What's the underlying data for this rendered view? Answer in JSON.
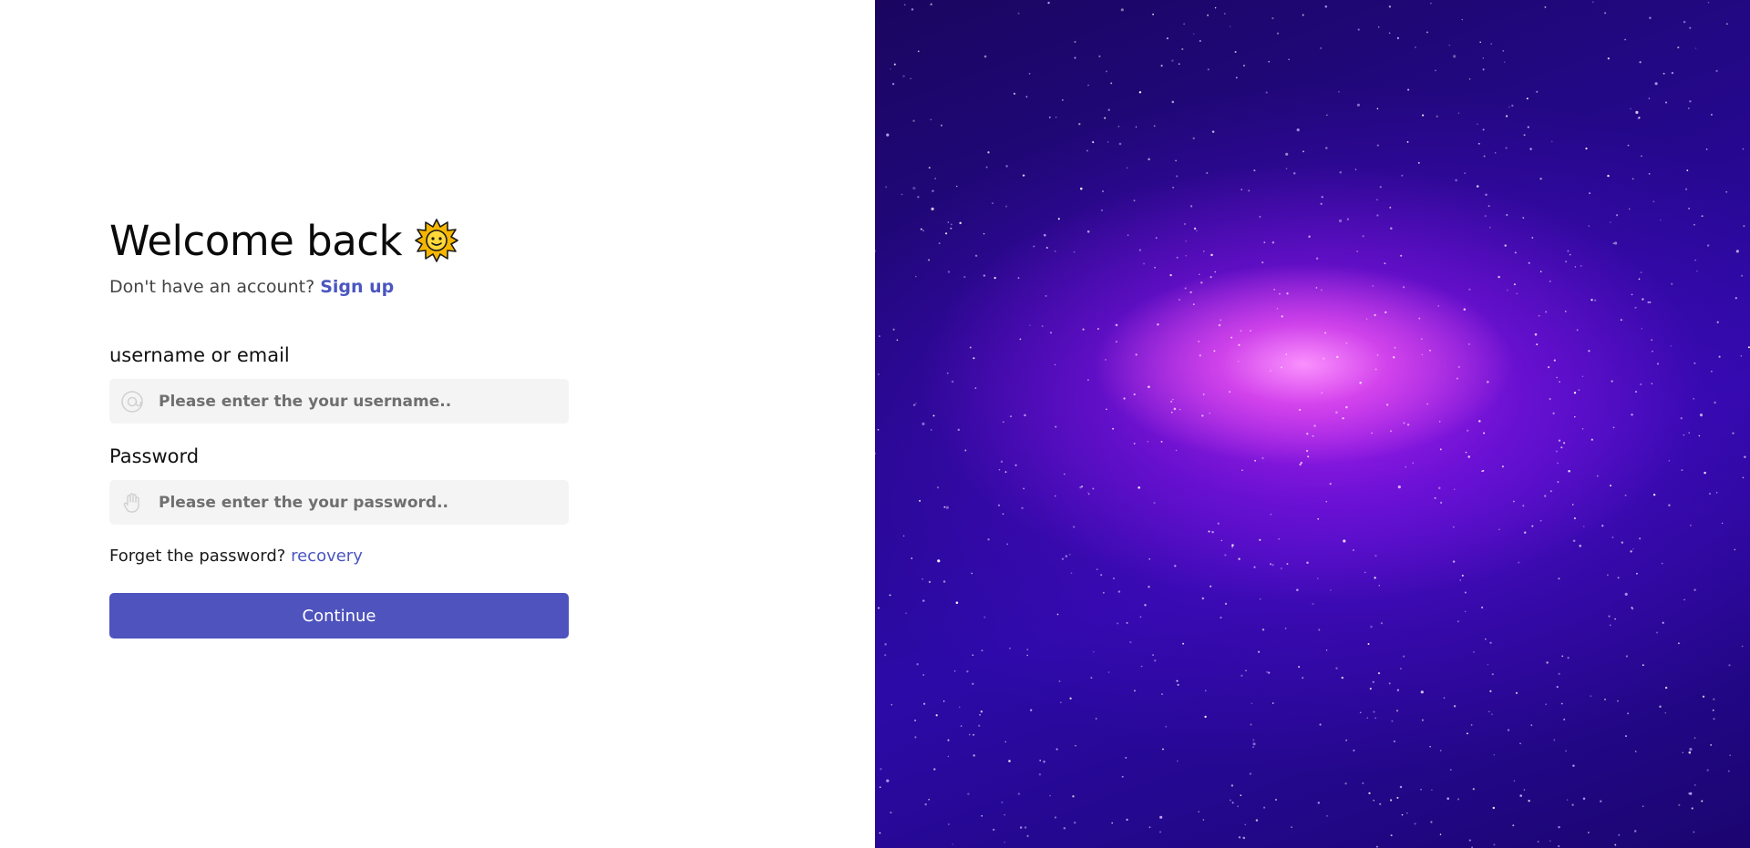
{
  "login": {
    "title": "Welcome back",
    "title_emoji": "sun-with-face",
    "subtitle_text": "Don't have an account?",
    "signup_link": "Sign up",
    "username_label": "username or email",
    "username_placeholder": "Please enter the your username..",
    "username_icon": "at-sign-icon",
    "password_label": "Password",
    "password_placeholder": "Please enter the your password..",
    "password_icon": "hand-icon",
    "forgot_text": "Forget the password?",
    "recovery_link": "recovery",
    "continue_label": "Continue"
  },
  "colors": {
    "accent": "#4e53bd",
    "link": "#4b56c0",
    "field_bg": "#f4f4f4",
    "galaxy_core": "#e060f0",
    "galaxy_bg": "#24088a"
  },
  "hero": {
    "image": "purple-galaxy"
  }
}
